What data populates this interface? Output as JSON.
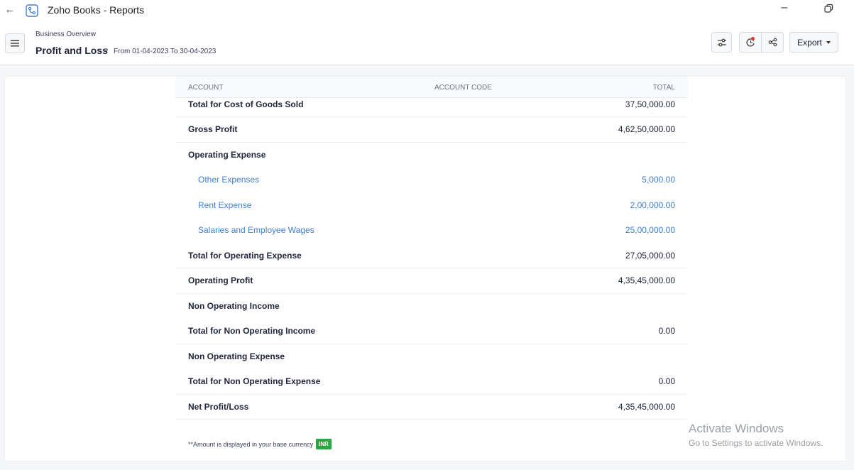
{
  "window": {
    "title": "Zoho Books - Reports"
  },
  "header": {
    "breadcrumb": "Business Overview",
    "title": "Profit and Loss",
    "date_range": "From 01-04-2023 To 30-04-2023",
    "export_label": "Export"
  },
  "table": {
    "columns": [
      "ACCOUNT",
      "ACCOUNT CODE",
      "TOTAL"
    ],
    "rows": [
      {
        "label": "Total for Cost of Goods Sold",
        "amount": "37,50,000.00"
      },
      {
        "label": "Gross Profit",
        "amount": "4,62,50,000.00"
      },
      {
        "label": "Operating Expense",
        "amount": ""
      },
      {
        "label": "Other Expenses",
        "amount": "5,000.00"
      },
      {
        "label": "Rent Expense",
        "amount": "2,00,000.00"
      },
      {
        "label": "Salaries and Employee Wages",
        "amount": "25,00,000.00"
      },
      {
        "label": "Total for Operating Expense",
        "amount": "27,05,000.00"
      },
      {
        "label": "Operating Profit",
        "amount": "4,35,45,000.00"
      },
      {
        "label": "Non Operating Income",
        "amount": ""
      },
      {
        "label": "Total for Non Operating Income",
        "amount": "0.00"
      },
      {
        "label": "Non Operating Expense",
        "amount": ""
      },
      {
        "label": "Total for Non Operating Expense",
        "amount": "0.00"
      },
      {
        "label": "Net Profit/Loss",
        "amount": "4,35,45,000.00"
      }
    ]
  },
  "footnote": {
    "text": "**Amount is displayed in your base currency",
    "currency": "INR"
  },
  "watermark": {
    "line1": "Activate Windows",
    "line2": "Go to Settings to activate Windows."
  },
  "colors": {
    "link": "#3f7fd0",
    "badge": "#29a745",
    "notification": "#e5322f"
  }
}
